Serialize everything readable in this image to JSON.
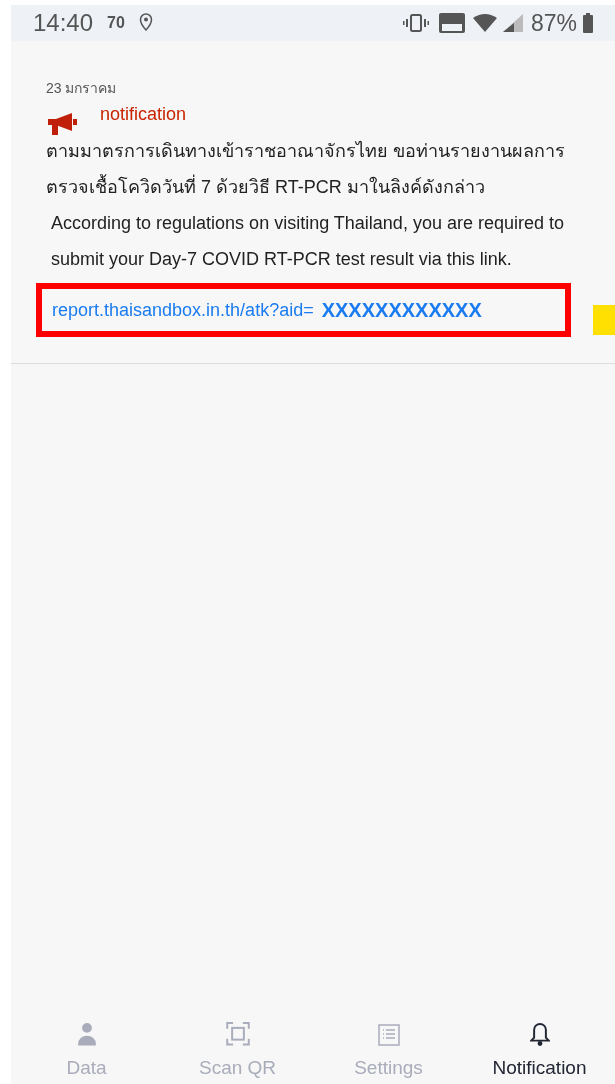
{
  "status_bar": {
    "time": "14:40",
    "indicator": "70",
    "battery": "87%"
  },
  "notification": {
    "date": "23 มกราคม",
    "title": "notification",
    "paragraphs": [
      "ตามมาตรการเดินทางเข้าราชอาณาจักรไทย ขอท่านรายงานผลการตรวจเชื้อโควิดวันที่ 7 ด้วยวิธี RT-PCR มาในลิงค์ดังกล่าว",
      "According to regulations on visiting Thailand, you are required to submit your Day-7 COVID RT-PCR test result via this link."
    ],
    "link": "report.thaisandbox.in.th/atk?aid=",
    "link_id": "XXXXXXXXXXXX"
  },
  "tabs": [
    {
      "label": "Data",
      "kind": "person",
      "selected": false
    },
    {
      "label": "Scan QR",
      "kind": "scan",
      "selected": false
    },
    {
      "label": "Settings",
      "kind": "list",
      "selected": false
    },
    {
      "label": "Notification",
      "kind": "bell",
      "selected": true
    }
  ]
}
